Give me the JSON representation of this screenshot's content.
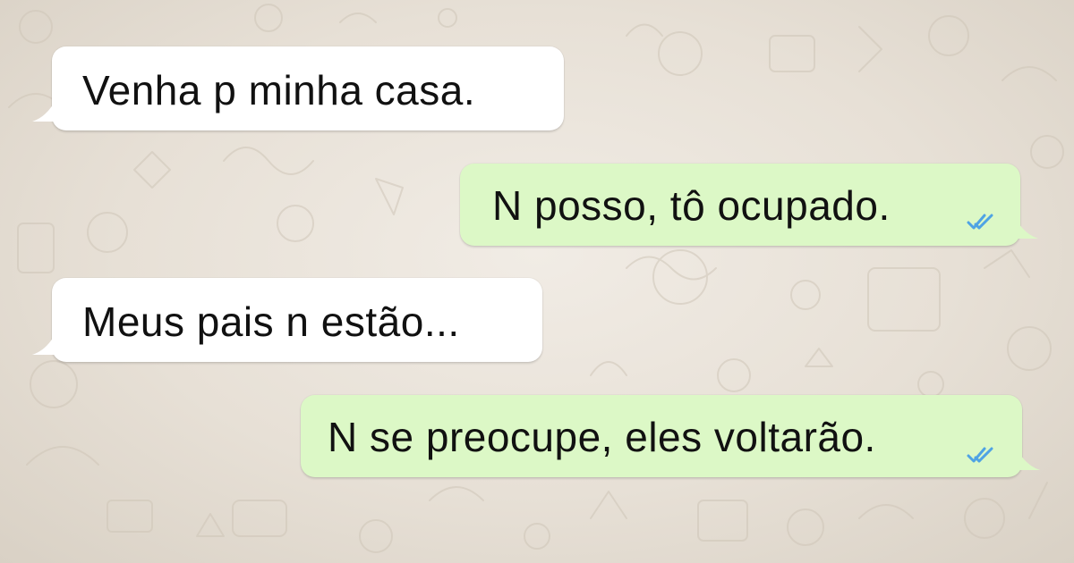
{
  "colors": {
    "incoming_bubble": "#ffffff",
    "outgoing_bubble": "#dcf8c6",
    "read_ticks": "#4fa3e4",
    "wallpaper": "#ece5dd"
  },
  "messages": [
    {
      "direction": "incoming",
      "text": "Venha p minha casa."
    },
    {
      "direction": "outgoing",
      "text": "N posso, tô ocupado.",
      "status": "read",
      "status_icon": "double-check-icon"
    },
    {
      "direction": "incoming",
      "text": "Meus pais n estão..."
    },
    {
      "direction": "outgoing",
      "text": "N se preocupe, eles voltarão.",
      "status": "read",
      "status_icon": "double-check-icon"
    }
  ]
}
